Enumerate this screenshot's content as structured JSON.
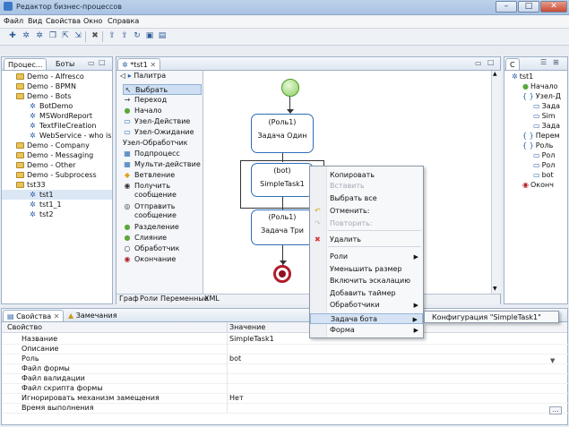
{
  "window": {
    "title": "Редактор бизнес-процессов",
    "buttons": [
      "–",
      "□",
      "✕"
    ]
  },
  "menu": [
    "Файл",
    "Вид",
    "Свойства",
    "Окно",
    "Справка"
  ],
  "toolbar_icons": [
    "new-icon",
    "gear-icon",
    "settings-icon",
    "copy-icon",
    "export-icon",
    "import-icon",
    "delete-icon",
    "deploy-icon",
    "deploy2-icon",
    "refresh-icon",
    "save-icon",
    "save-all-icon"
  ],
  "left_panel": {
    "tabs": [
      "Процес...",
      "Боты"
    ],
    "tree": [
      {
        "label": "Demo - Alfresco",
        "type": "folder",
        "level": 1
      },
      {
        "label": "Demo - BPMN",
        "type": "folder",
        "level": 1
      },
      {
        "label": "Demo - Bots",
        "type": "folder",
        "level": 1
      },
      {
        "label": "BotDemo",
        "type": "item",
        "level": 2
      },
      {
        "label": "MSWordReport",
        "type": "item",
        "level": 2
      },
      {
        "label": "TextFileCreation",
        "type": "item",
        "level": 2
      },
      {
        "label": "WebService - who is",
        "type": "item",
        "level": 2
      },
      {
        "label": "Demo - Company",
        "type": "folder",
        "level": 1
      },
      {
        "label": "Demo - Messaging",
        "type": "folder",
        "level": 1
      },
      {
        "label": "Demo - Other",
        "type": "folder",
        "level": 1
      },
      {
        "label": "Demo - Subprocess",
        "type": "folder",
        "level": 1
      },
      {
        "label": "tst33",
        "type": "folder",
        "level": 1
      },
      {
        "label": "tst1",
        "type": "item",
        "level": 2,
        "selected": true
      },
      {
        "label": "tst1_1",
        "type": "item",
        "level": 2
      },
      {
        "label": "tst2",
        "type": "item",
        "level": 2
      }
    ]
  },
  "editor": {
    "tab": "*tst1",
    "palette_title": "Палитра",
    "palette": [
      {
        "label": "Выбрать",
        "icon": "cursor-icon",
        "selected": true
      },
      {
        "label": "Переход",
        "icon": "arrow-icon"
      },
      {
        "label": "Начало",
        "icon": "start-icon"
      },
      {
        "label": "Узел-Действие",
        "icon": "task-icon"
      },
      {
        "label": "Узел-Ожидание",
        "icon": "wait-icon"
      },
      {
        "label": "Узел-Обработчик",
        "icon": ""
      },
      {
        "label": "Подпроцесс",
        "icon": "subprocess-icon"
      },
      {
        "label": "Мульти-действие",
        "icon": "multi-icon"
      },
      {
        "label": "Ветвление",
        "icon": "branch-icon"
      },
      {
        "label": "Получить сообщение",
        "icon": "receive-icon"
      },
      {
        "label": "Отправить сообщение",
        "icon": "send-icon"
      },
      {
        "label": "Разделение",
        "icon": "fork-icon"
      },
      {
        "label": "Слияние",
        "icon": "join-icon"
      },
      {
        "label": "Обработчик",
        "icon": "handler-icon"
      },
      {
        "label": "Окончание",
        "icon": "end-icon"
      }
    ],
    "nodes": [
      {
        "role": "(Роль1)",
        "name": "Задача Один"
      },
      {
        "role": "(bot)",
        "name": "SimpleTask1"
      },
      {
        "role": "(Роль1)",
        "name": "Задача Три"
      }
    ],
    "bottom_tabs": [
      "Граф",
      "Роли",
      "Переменные",
      "XML"
    ]
  },
  "outline": {
    "tab": "С",
    "tree": [
      {
        "label": "tst1",
        "level": 0
      },
      {
        "label": "Начало",
        "level": 1
      },
      {
        "label": "Узел-Д",
        "level": 1
      },
      {
        "label": "Зада",
        "level": 2
      },
      {
        "label": "Sim",
        "level": 2
      },
      {
        "label": "Зада",
        "level": 2
      },
      {
        "label": "Перем",
        "level": 1
      },
      {
        "label": "Роль",
        "level": 1
      },
      {
        "label": "Рол",
        "level": 2
      },
      {
        "label": "Рол",
        "level": 2
      },
      {
        "label": "bot",
        "level": 2
      },
      {
        "label": "Оконч",
        "level": 1
      }
    ]
  },
  "context_menu": {
    "items": [
      {
        "label": "Копировать",
        "enabled": true
      },
      {
        "label": "Вставить",
        "enabled": false
      },
      {
        "label": "Выбрать все",
        "enabled": true
      },
      {
        "label": "Отменить:",
        "enabled": true,
        "icon": "undo-icon"
      },
      {
        "label": "Повторить:",
        "enabled": false,
        "icon": "redo-icon"
      },
      {
        "label": "Удалить",
        "enabled": true,
        "icon": "delete-icon"
      },
      {
        "label": "Роли",
        "enabled": true,
        "submenu": true
      },
      {
        "label": "Уменьшить размер",
        "enabled": true
      },
      {
        "label": "Включить эскалацию",
        "enabled": true
      },
      {
        "label": "Добавить таймер",
        "enabled": true
      },
      {
        "label": "Обработчики",
        "enabled": true,
        "submenu": true
      },
      {
        "label": "Задача бота",
        "enabled": true,
        "submenu": true,
        "highlighted": true
      },
      {
        "label": "Форма",
        "enabled": true,
        "submenu": true
      }
    ],
    "submenu_item": "Конфигурация \"SimpleTask1\""
  },
  "properties": {
    "tabs": [
      "Свойства",
      "Замечания"
    ],
    "col_property": "Свойство",
    "col_value": "Значение",
    "rows": [
      {
        "name": "Название",
        "value": "SimpleTask1"
      },
      {
        "name": "Описание",
        "value": ""
      },
      {
        "name": "Роль",
        "value": "bot"
      },
      {
        "name": "Файл формы",
        "value": ""
      },
      {
        "name": "Файл валидации",
        "value": ""
      },
      {
        "name": "Файл скрипта формы",
        "value": ""
      },
      {
        "name": "Игнорировать механизм замещения",
        "value": "Нет"
      },
      {
        "name": "Время выполнения",
        "value": ""
      }
    ]
  }
}
